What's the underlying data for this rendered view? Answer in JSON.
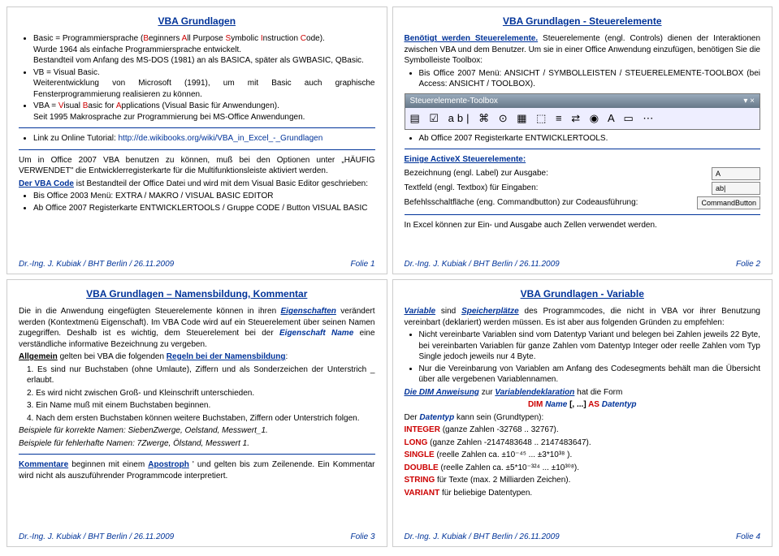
{
  "s1": {
    "title": "VBA Grundlagen",
    "li1a": "Basic = Programmiersprache (",
    "li1b": "eginners ",
    "li1c": "ll Purpose ",
    "li1d": "ymbolic ",
    "li1e": "nstruction ",
    "li1f": "ode).",
    "li1sub1": "Wurde 1964 als einfache Programmiersprache entwickelt.",
    "li1sub2": "Bestandteil vom Anfang des MS-DOS (1981) an als BASICA, später als GWBASIC, QBasic.",
    "li2": "VB = Visual Basic.",
    "li2sub": "Weiterentwicklung von Microsoft (1991), um mit Basic auch graphische Fensterprogrammierung realisieren zu können.",
    "li3a": "VBA = ",
    "li3b": "isual ",
    "li3c": "asic for ",
    "li3d": "pplications (Visual Basic für Anwendungen).",
    "li3sub": "Seit 1995 Makrosprache zur Programmierung bei MS-Office Anwendungen.",
    "linkLabel": "Link zu Online Tutorial: ",
    "linkUrl": "http://de.wikibooks.org/wiki/VBA_in_Excel_-_Grundlagen",
    "p1": "Um in Office 2007 VBA benutzen zu können, muß bei den Optionen unter „HÄUFIG VERWENDET\" die Entwicklerregisterkarte für die Multifunktionsleiste aktiviert werden.",
    "p2a": "Der VBA Code",
    "p2b": " ist Bestandteil der Office Datei und wird mit dem Visual Basic Editor geschrieben:",
    "li4": "Bis Office 2003 Menü: EXTRA / MAKRO / VISUAL BASIC EDITOR",
    "li5": "Ab Office 2007 Registerkarte ENTWICKLERTOOLS / Gruppe CODE / Button VISUAL BASIC",
    "footerL": "Dr.-Ing. J. Kubiak / BHT Berlin / 26.11.2009",
    "footerR": "Folie 1"
  },
  "s2": {
    "title": "VBA Grundlagen - Steuerelemente",
    "p1a": "Benötigt werden Steuerelemente.",
    "p1b": " Steuerelemente (engl. Controls) dienen der Interaktionen zwischen VBA und dem Benutzer. Um sie in einer Office Anwendung einzufügen, benötigen Sie die Symbolleiste Toolbox:",
    "li1": "Bis Office 2007 Menü: ANSICHT / SYMBOLLEISTEN / STEUERELEMENTE-TOOLBOX (bei Access: ANSICHT / TOOLBOX).",
    "toolboxTitle": "Steuerelemente-Toolbox",
    "toolboxIcons": "▤ ☑ ab| ⌘ ⊙ ▦ ⬚ ≡ ⇄ ◉ A ▭ ⋯",
    "li2": "Ab Office 2007 Registerkarte ENTWICKLERTOOLS.",
    "sub": "Einige ActiveX Steuerelemente:",
    "row1": "Bezeichnung (engl. Label) zur Ausgabe:",
    "row1s": "A",
    "row2": "Textfeld (engl. Textbox) für Eingaben:",
    "row2s": "ab|",
    "row3": "Befehlsschaltfläche (eng. Commandbutton) zur Codeausführung:",
    "row3s": "CommandButton",
    "note": "In Excel können zur Ein- und Ausgabe auch Zellen verwendet werden.",
    "footerL": "Dr.-Ing. J. Kubiak / BHT Berlin / 26.11.2009",
    "footerR": "Folie 2"
  },
  "s3": {
    "title": "VBA Grundlagen – Namensbildung, Kommentar",
    "p1a": "Die in die Anwendung eingefügten Steuerelemente können in ihren ",
    "p1b": "Eigenschaften",
    "p1c": " verändert werden (Kontextmenü Eigenschaft). Im VBA Code wird auf ein Steuerelement über seinen Namen zugegriffen. Deshalb ist es wichtig, dem Steuerelement bei der ",
    "p1d": "Eigenschaft Name",
    "p1e": " eine verständliche informative Bezeichnung zu vergeben.",
    "p2a": "Allgemein",
    "p2b": " gelten bei VBA die folgenden ",
    "p2c": "Regeln bei der Namensbildung",
    "p2d": ":",
    "r1": "1. Es sind nur Buchstaben (ohne Umlaute), Ziffern und als Sonderzeichen der Unterstrich _ erlaubt.",
    "r2": "2. Es wird nicht zwischen Groß- und Kleinschrift unterschieden.",
    "r3": "3. Ein Name muß mit einem Buchstaben beginnen.",
    "r4": "4. Nach dem ersten Buchstaben können weitere Buchstaben, Ziffern oder Unterstrich folgen.",
    "ex1": "Beispiele für korrekte Namen: SiebenZwerge, Oelstand, Messwert_1.",
    "ex2": "Beispiele für fehlerhafte Namen: 7Zwerge, Ölstand, Messwert 1.",
    "k1a": "Kommentare",
    "k1b": " beginnen mit einem ",
    "k1c": "Apostroph",
    "k1d": " ' und gelten bis zum Zeilenende. Ein Kommentar wird nicht als auszuführender Programmcode interpretiert.",
    "footerL": "Dr.-Ing. J. Kubiak / BHT Berlin / 26.11.2009",
    "footerR": "Folie 3"
  },
  "s4": {
    "title": "VBA Grundlagen  - Variable",
    "p1a": "Variable",
    "p1b": " sind ",
    "p1c": "Speicherplätze",
    "p1d": " des Programmcodes, die nicht in VBA vor ihrer Benutzung vereinbart (deklariert) werden müssen. Es ist aber aus folgenden Gründen zu empfehlen:",
    "li1": "Nicht vereinbarte Variablen sind vom Datentyp Variant und belegen bei Zahlen jeweils 22 Byte, bei vereinbarten Variablen für ganze Zahlen vom Datentyp Integer oder reelle Zahlen vom Typ Single jedoch jeweils nur 4 Byte.",
    "li2": "Nur die Vereinbarung von Variablen am Anfang des Codesegments behält man die Übersicht über alle vergebenen Variablennamen.",
    "dim1": "Die DIM Anweisung",
    "dim2": " zur ",
    "dim3": "Variablendeklaration",
    "dim4": " hat die Form",
    "dimSyntax1": "DIM ",
    "dimSyntax2": "Name",
    "dimSyntax3": " [, ...] ",
    "dimSyntax4": "AS ",
    "dimSyntax5": "Datentyp",
    "dt1": "Der ",
    "dt2": "Datentyp",
    "dt3": " kann sein (Grundtypen):",
    "tINT": "INTEGER",
    "tINTd": " (ganze Zahlen -32768 .. 32767).",
    "tLONG": "LONG",
    "tLONGd": " (ganze Zahlen -2147483648 .. 2147483647).",
    "tSING": "SINGLE",
    "tSINGd": " (reelle Zahlen ca. ±10⁻⁴⁵ ... ±3*10³⁸ ).",
    "tDBL": "DOUBLE",
    "tDBLd": " (reelle Zahlen ca. ±5*10⁻³²⁴ ... ±10³⁰⁸).",
    "tSTR": "STRING",
    "tSTRd": " für Texte (max. 2 Milliarden Zeichen).",
    "tVAR": "VARIANT",
    "tVARd": " für beliebige Datentypen.",
    "footerL": "Dr.-Ing. J. Kubiak / BHT Berlin / 26.11.2009",
    "footerR": "Folie 4"
  }
}
